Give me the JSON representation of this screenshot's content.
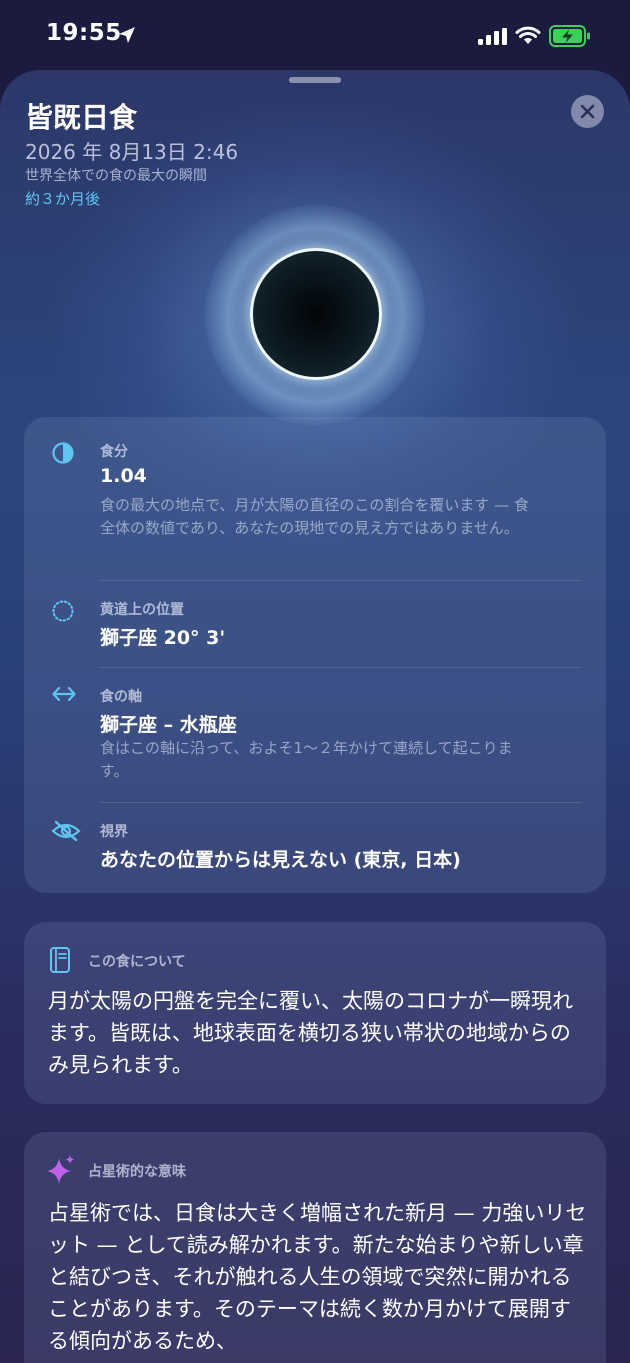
{
  "status_bar": {
    "time": "19:55"
  },
  "sheet": {
    "title": "皆既日食",
    "datetime": "2026 年 8月13日 2:46",
    "caption": "世界全体での食の最大の瞬間",
    "relative": "約３か月後"
  },
  "info": {
    "magnitude": {
      "label": "食分",
      "value": "1.04",
      "desc": "食の最大の地点で、月が太陽の直径のこの割合を覆います — 食全体の数値であり、あなたの現地での見え方ではありません。"
    },
    "ecliptic": {
      "label": "黄道上の位置",
      "value": "獅子座 20° 3'"
    },
    "axis": {
      "label": "食の軸",
      "value": "獅子座 – 水瓶座",
      "desc": "食はこの軸に沿って、およそ1〜２年かけて連続して起こります。"
    },
    "visibility": {
      "label": "視界",
      "value": "あなたの位置からは見えない (東京, 日本)"
    }
  },
  "about": {
    "heading": "この食について",
    "body": "月が太陽の円盤を完全に覆い、太陽のコロナが一瞬現れます。皆既は、地球表面を横切る狭い帯状の地域からのみ見られます。"
  },
  "astro": {
    "heading": "占星術的な意味",
    "body": "占星術では、日食は大きく増幅された新月 — 力強いリセット — として読み解かれます。新たな始まりや新しい章と結びつき、それが触れる人生の領域で突然に開かれることがあります。そのテーマは続く数か月かけて展開する傾向があるため、"
  },
  "colors": {
    "accent": "#5fc6f2",
    "astro_icon": "#c062e8"
  }
}
